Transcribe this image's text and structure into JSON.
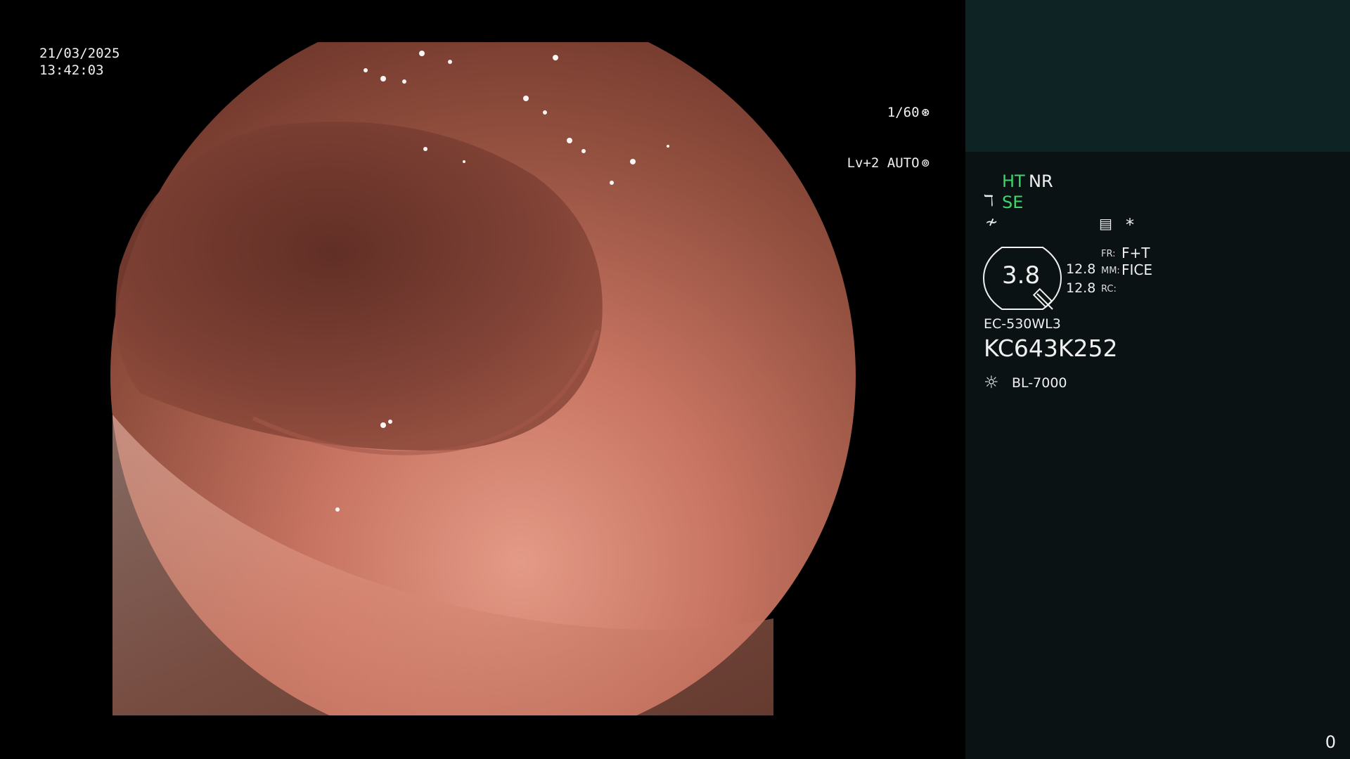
{
  "osd": {
    "date": "21/03/2025",
    "time": "13:42:03",
    "shutter": "1/60",
    "level_mode": "Lv+2 AUTO"
  },
  "status": {
    "ht": "HT",
    "nr": "NR",
    "se": "SE",
    "asterisk": "*",
    "zoom": "3.8",
    "val_top": "12.8",
    "val_bottom": "12.8",
    "fr_label": "FR:",
    "fr_value": "F+T",
    "mm_label": "MM:",
    "mm_value": "FICE",
    "rc_label": "RC:",
    "scope_model": "EC-530WL3",
    "scope_serial": "KC643K252",
    "light_source": "BL-7000",
    "frame_count": "0"
  },
  "colors": {
    "panel_bg": "#0a1213",
    "panel_top_bg": "#0d2324",
    "status_green": "#3ed66a"
  },
  "icons": [
    "shutter-icon",
    "auto-iris-icon",
    "scope-tip-icon",
    "distal-attachment-icon",
    "memo-icon",
    "light-source-icon"
  ]
}
